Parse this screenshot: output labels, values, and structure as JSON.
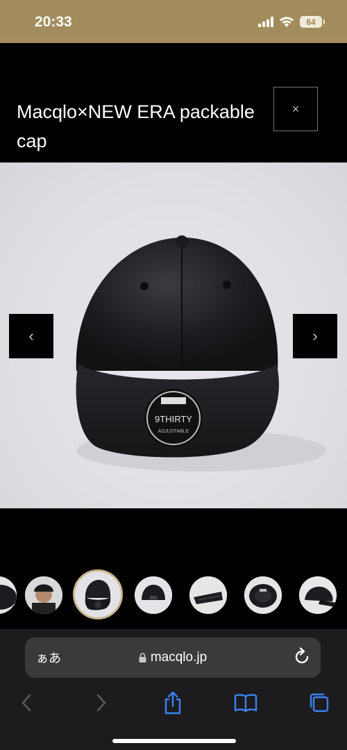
{
  "status_bar": {
    "time": "20:33",
    "battery": "64",
    "icons": [
      "signal-icon",
      "wifi-icon",
      "battery-icon"
    ]
  },
  "modal": {
    "title": "Macqlo×NEW ERA packable cap",
    "close_label": "×"
  },
  "gallery": {
    "prev_label": "‹",
    "next_label": "›",
    "main_image": "black-cap-photo",
    "cap_brand_label": "9THIRTY",
    "cap_sub_label": "ADJUSTABLE",
    "thumbnails": [
      {
        "name": "thumb-cap-side-partial",
        "active": false
      },
      {
        "name": "thumb-model-wearing-cap",
        "active": false
      },
      {
        "name": "thumb-cap-front",
        "active": true
      },
      {
        "name": "thumb-cap-back",
        "active": false
      },
      {
        "name": "thumb-cap-folded",
        "active": false
      },
      {
        "name": "thumb-cap-inside",
        "active": false
      },
      {
        "name": "thumb-cap-side",
        "active": false
      }
    ]
  },
  "safari": {
    "aa_label": "ぁあ",
    "url": "macqlo.jp",
    "toolbar": [
      "back-icon",
      "forward-icon",
      "share-icon",
      "bookmarks-icon",
      "tabs-icon"
    ]
  },
  "colors": {
    "status_bar_bg": "#a18b5c",
    "accent_blue": "#3b82f6",
    "thumb_active_border": "#c9b58b"
  }
}
